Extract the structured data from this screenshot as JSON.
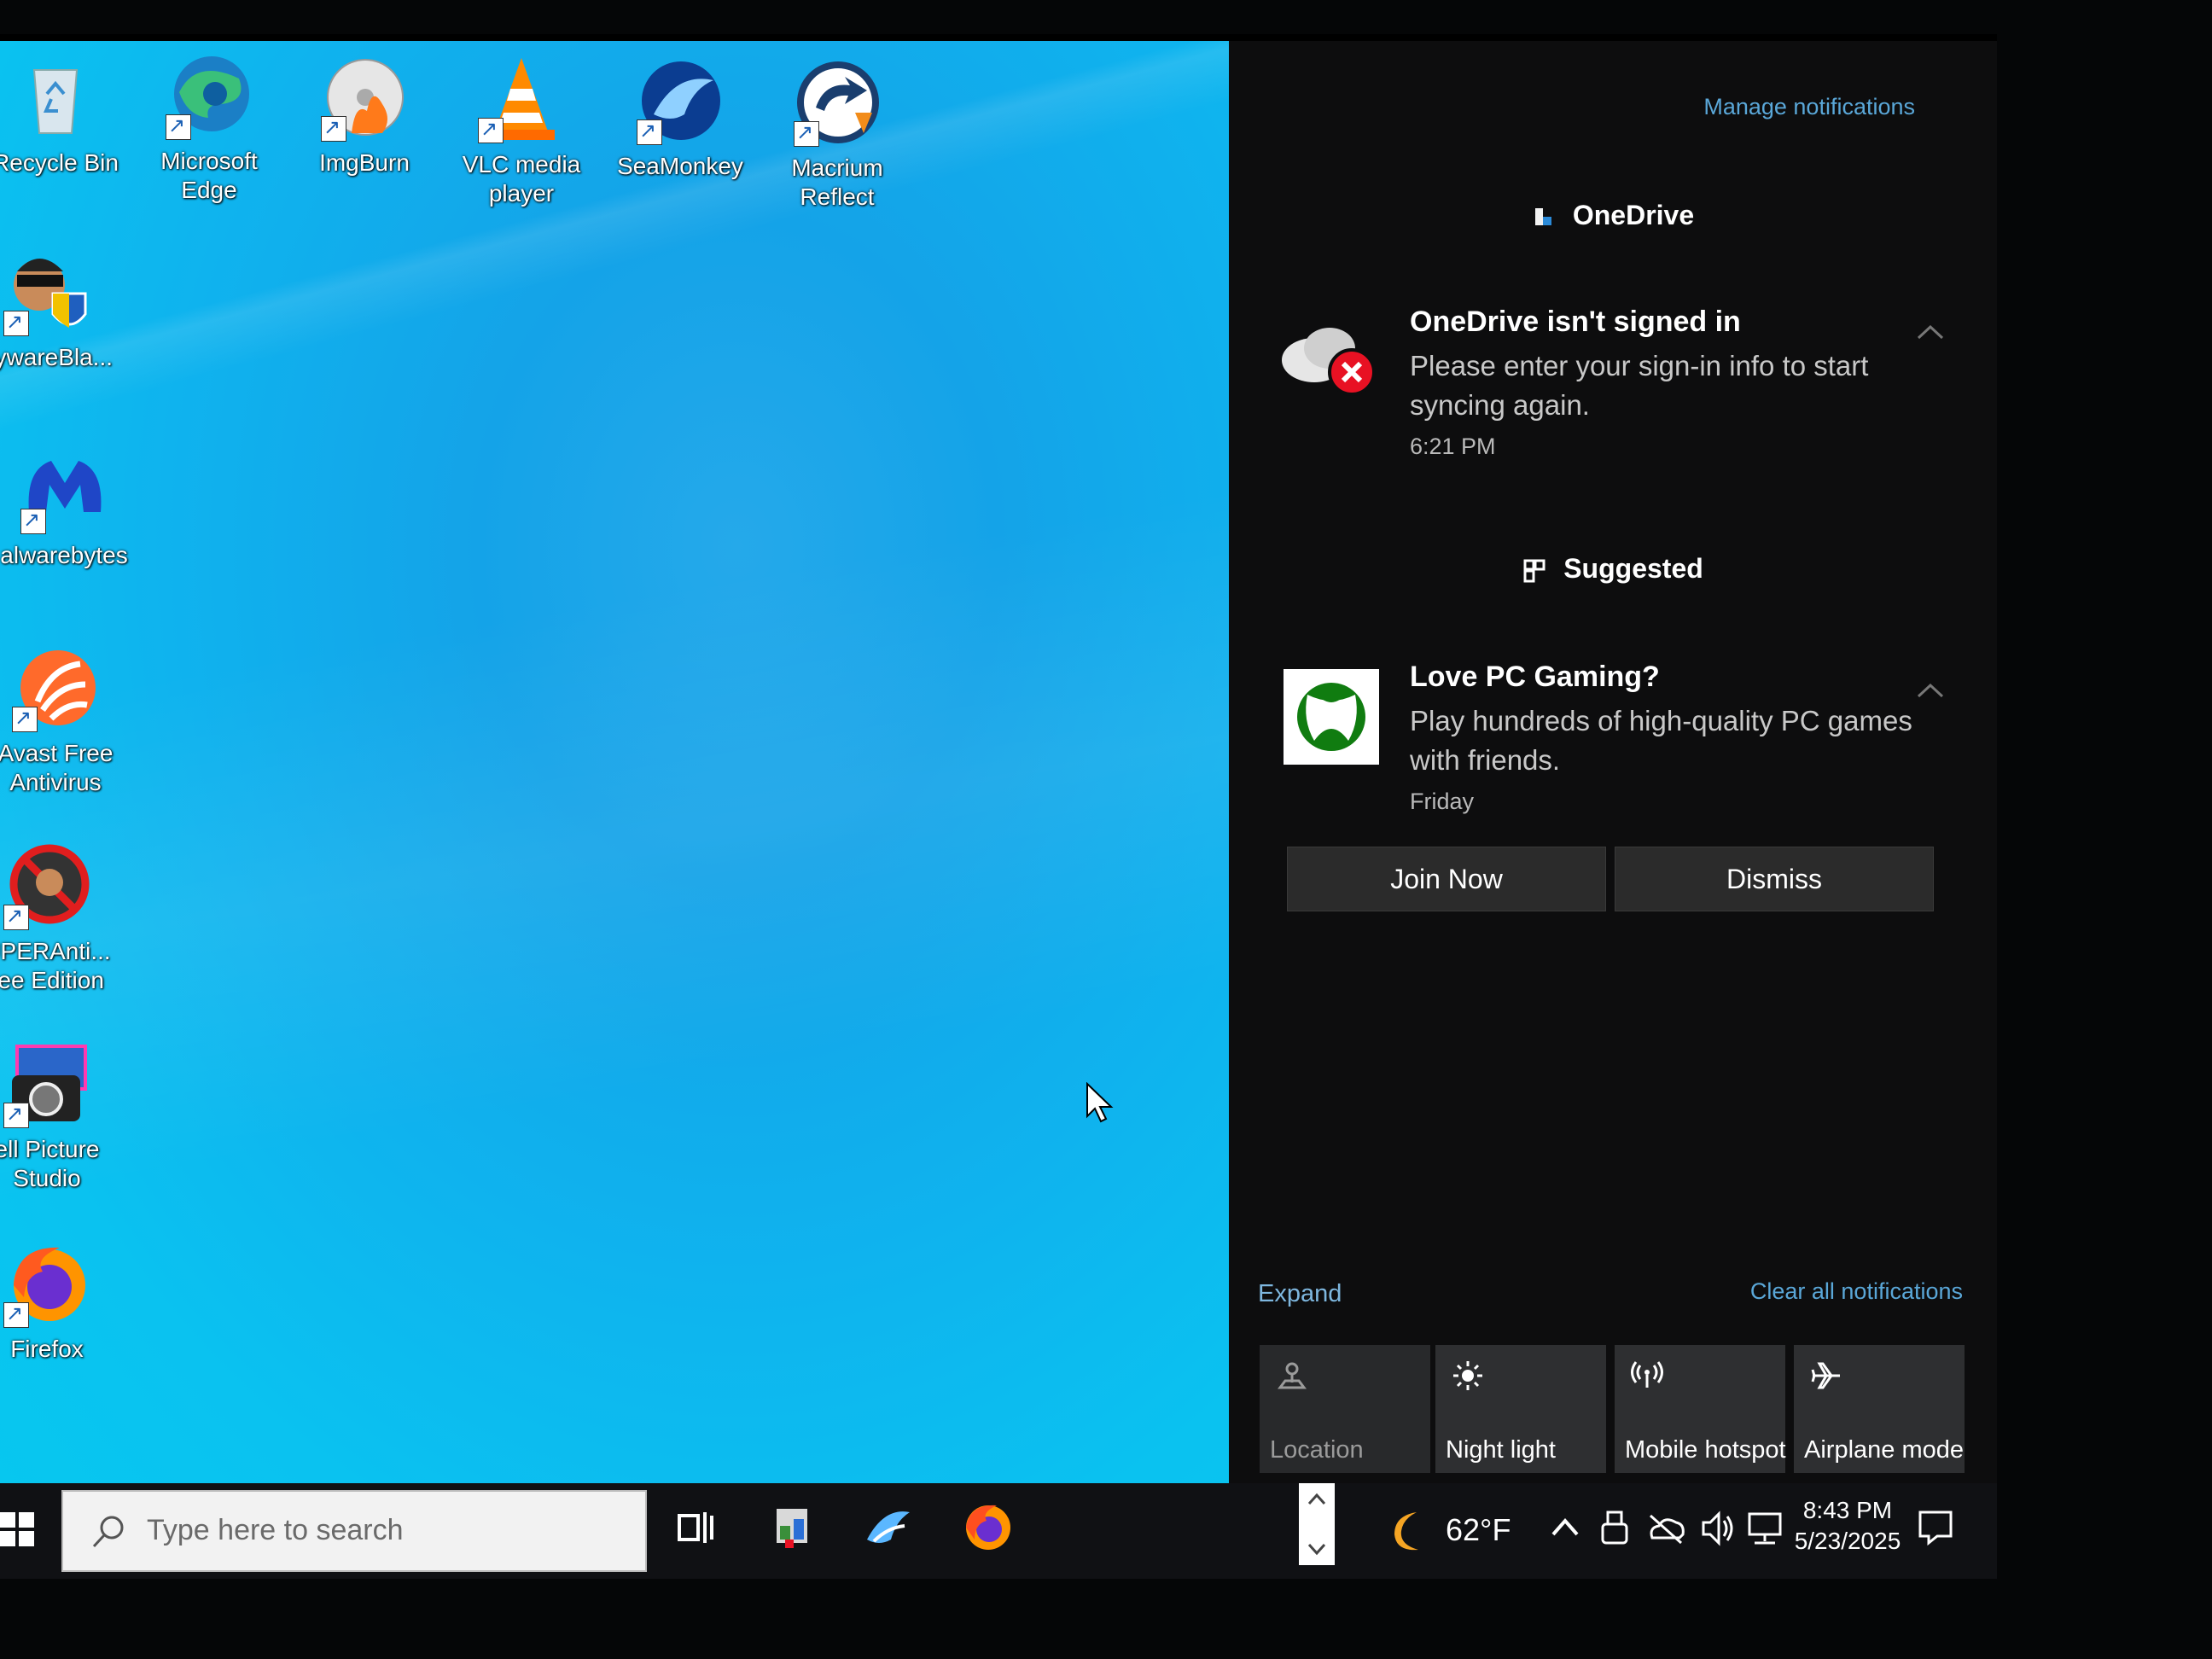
{
  "desktop": {
    "icons": [
      {
        "label": "Recycle Bin"
      },
      {
        "label": "Microsoft Edge"
      },
      {
        "label": "ImgBurn"
      },
      {
        "label": "VLC media player"
      },
      {
        "label": "SeaMonkey"
      },
      {
        "label": "Macrium Reflect"
      },
      {
        "label": "pywareBla..."
      },
      {
        "label": "alwarebytes"
      },
      {
        "label": "Avast Free Antivirus"
      },
      {
        "label": "UPERAnti... ree Edition"
      },
      {
        "label": "ell Picture Studio"
      },
      {
        "label": "Firefox"
      }
    ]
  },
  "action_center": {
    "manage_label": "Manage notifications",
    "groups": [
      {
        "app": "OneDrive",
        "title": "OneDrive isn't signed in",
        "body": "Please enter your sign-in info to start syncing again.",
        "time": "6:21 PM"
      },
      {
        "app": "Suggested",
        "title": "Love PC Gaming?",
        "body": "Play hundreds of high-quality PC games with friends.",
        "time": "Friday",
        "buttons": [
          "Join Now",
          "Dismiss"
        ]
      }
    ],
    "expand_label": "Expand",
    "clear_label": "Clear all notifications",
    "quick_actions": [
      {
        "label": "Location",
        "icon": "location-icon",
        "state": "off"
      },
      {
        "label": "Night light",
        "icon": "brightness-icon",
        "state": "on"
      },
      {
        "label": "Mobile hotspot",
        "icon": "hotspot-icon",
        "state": "on"
      },
      {
        "label": "Airplane mode",
        "icon": "airplane-icon",
        "state": "on"
      }
    ]
  },
  "taskbar": {
    "search_placeholder": "Type here to search",
    "weather": "62°F",
    "time": "8:43 PM",
    "date": "5/23/2025"
  },
  "colors": {
    "desktop_blue": "#14a3e8",
    "link_blue": "#5aa7d8",
    "panel_bg": "#0d0d0e",
    "error_red": "#e81123"
  }
}
